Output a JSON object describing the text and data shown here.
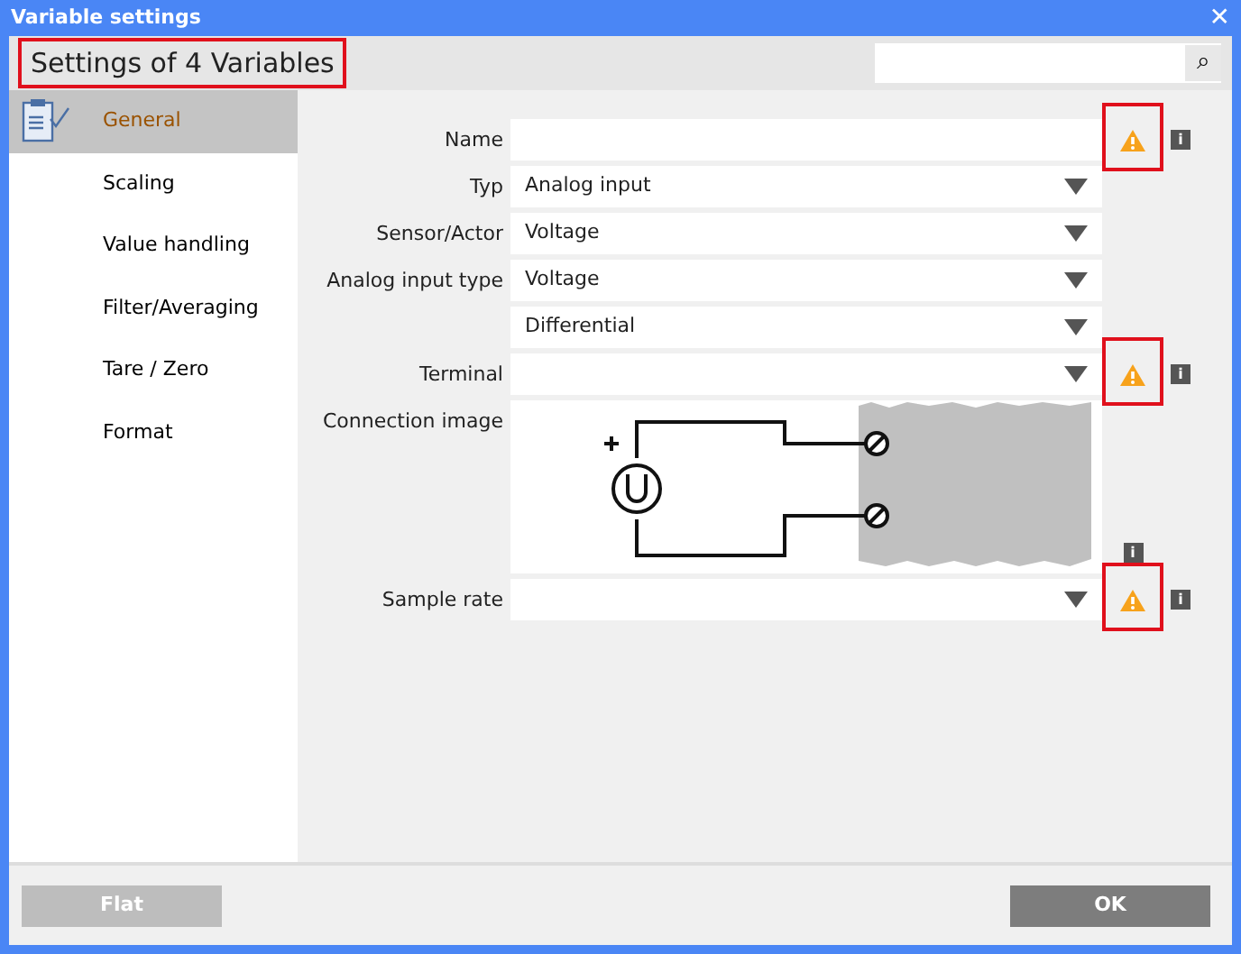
{
  "window": {
    "title": "Variable settings",
    "close": "✕"
  },
  "header": {
    "title": "Settings of 4 Variables",
    "highlighted": true,
    "search_icon": "⌕"
  },
  "sidebar": {
    "items": [
      {
        "label": "General",
        "selected": true
      },
      {
        "label": "Scaling",
        "selected": false
      },
      {
        "label": "Value handling",
        "selected": false
      },
      {
        "label": "Filter/Averaging",
        "selected": false
      },
      {
        "label": "Tare / Zero",
        "selected": false
      },
      {
        "label": "Format",
        "selected": false
      }
    ]
  },
  "fields": [
    {
      "kind": "text",
      "label": "Name",
      "warning": true,
      "highlighted": true,
      "info": "i"
    },
    {
      "kind": "dropdown",
      "label": "Typ",
      "value": "Analog input",
      "warning": false,
      "highlighted": false
    },
    {
      "kind": "dropdown",
      "label": "Sensor/Actor",
      "value": "Voltage",
      "warning": false,
      "highlighted": false
    },
    {
      "kind": "dropdown",
      "label": "Analog input type",
      "value": "Voltage",
      "warning": false,
      "highlighted": false
    },
    {
      "kind": "dropdown",
      "value": "Differential",
      "warning": false,
      "highlighted": false
    },
    {
      "kind": "dropdown",
      "label": "Terminal",
      "warning": true,
      "highlighted": true,
      "info": "i"
    },
    {
      "kind": "image",
      "label": "Connection image",
      "warning": false,
      "highlighted": false,
      "info": "i"
    },
    {
      "kind": "dropdown",
      "label": "Sample rate",
      "warning": true,
      "highlighted": true,
      "info": "i"
    }
  ],
  "buttons": [
    {
      "label": "Flat",
      "disabled": true
    },
    {
      "label": "OK",
      "disabled": false
    }
  ]
}
